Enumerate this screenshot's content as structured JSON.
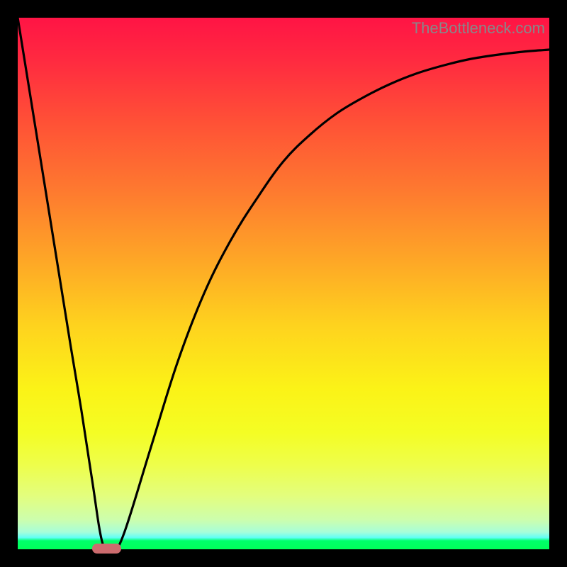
{
  "watermark": "TheBottleneck.com",
  "chart_data": {
    "type": "line",
    "title": "",
    "xlabel": "",
    "ylabel": "",
    "xlim": [
      0,
      100
    ],
    "ylim": [
      0,
      100
    ],
    "x": [
      0,
      5,
      10,
      12,
      14,
      16,
      18,
      20,
      25,
      30,
      35,
      40,
      45,
      50,
      55,
      60,
      65,
      70,
      75,
      80,
      85,
      90,
      95,
      100
    ],
    "values": [
      100,
      69,
      38,
      26,
      13,
      1,
      0,
      3,
      19,
      35,
      48,
      58,
      66,
      73,
      78,
      82,
      85,
      87.5,
      89.5,
      91,
      92.2,
      93,
      93.6,
      94
    ],
    "marker": {
      "x_range": [
        14,
        19.5
      ],
      "y": 0
    },
    "grid": false,
    "annotations": []
  },
  "colors": {
    "curve": "#000000",
    "marker": "#cc6b6e",
    "gradient_top": "#ff1445",
    "gradient_bottom": "#00ff5a"
  }
}
